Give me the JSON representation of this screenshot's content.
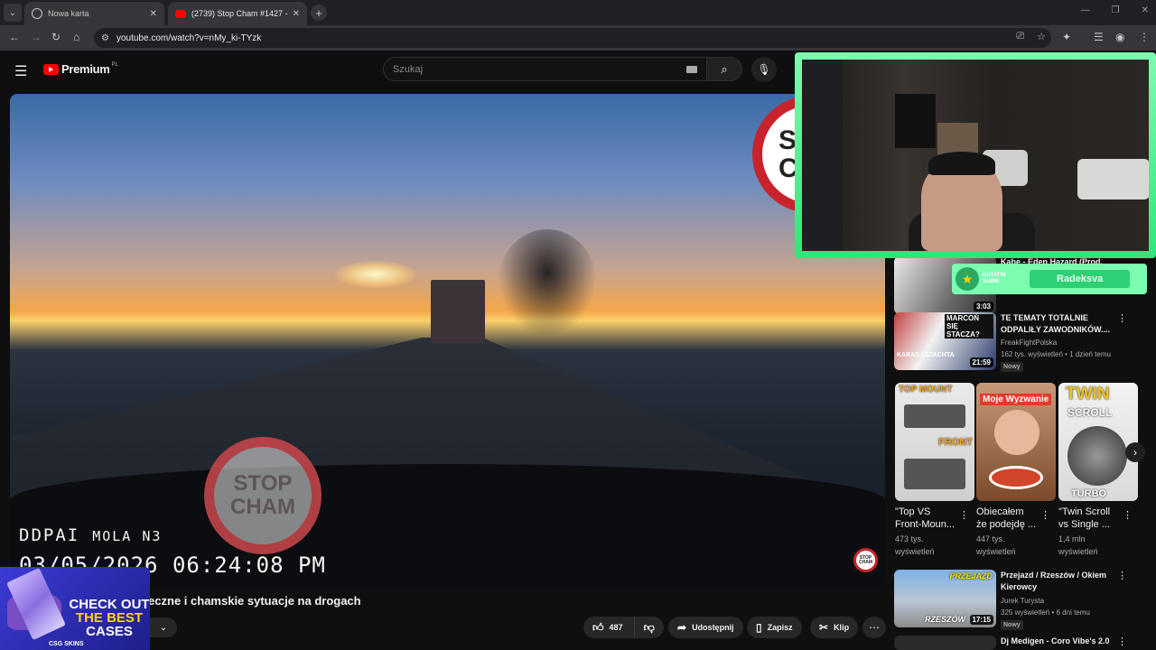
{
  "browser": {
    "tabs": [
      {
        "title": "Nowa karta",
        "active": false
      },
      {
        "title": "(2739) Stop Cham #1427 - Niebe",
        "active": true
      }
    ],
    "url": "youtube.com/watch?v=nMy_ki-TYzk"
  },
  "header": {
    "logo_text": "Premium",
    "logo_region": "PL",
    "search_placeholder": "Szukaj"
  },
  "player": {
    "dashcam_brand": "DDPAI",
    "dashcam_model": "MOLA N3",
    "dashcam_timestamp": "03/05/2026 06:24:08 PM",
    "watermark_line1": "STOP",
    "watermark_line2": "CHAM",
    "corner_logo_line1": "STOP",
    "corner_logo_line2": "CHAM",
    "big_logo_line1": "ST",
    "big_logo_line2": "C"
  },
  "video": {
    "title": "zpieczne i chamskie sytuacje na drogach",
    "likes": "487",
    "share_label": "Udostępnij",
    "save_label": "Zapisz",
    "clip_label": "Klip"
  },
  "ad": {
    "line1": "CHECK OUT",
    "line2": "THE BEST",
    "line3": "CASES",
    "brand": "CSG SKINS"
  },
  "stream_overlay": {
    "sub_label": "OSTATNI SUBIK",
    "sub_name": "Radeksva"
  },
  "sidebar": {
    "items": [
      {
        "title": "Kabe - Eden Hazard (Prod.",
        "channel": "",
        "meta": "",
        "duration": "3:03",
        "badge": ""
      },
      {
        "title": "TE TEMATY TOTALNIE ODPALIŁY ZAWODNIKÓW....",
        "channel": "FreakFightPolska",
        "meta": "162 tys. wyświetleń • 1 dzień temu",
        "duration": "21:59",
        "badge": "Nowy"
      },
      {
        "title": "Przejazd / Rzeszów / Okiem Kierowcy",
        "channel": "Jurek Turysta",
        "meta": "325 wyświetleń • 6 dni temu",
        "duration": "17:15",
        "badge": "Nowy"
      },
      {
        "title": "Dj Medigen - Coro Vibe's 2.0",
        "channel": "",
        "meta": "",
        "duration": "",
        "badge": ""
      }
    ],
    "shorts": [
      {
        "title": "\"Top VS\nFront-Moun...",
        "meta": "473 tys.\nwyświetleń",
        "overlay": ""
      },
      {
        "title": "Obiecałem\nże podejdę ...",
        "meta": "447 tys.\nwyświetleń",
        "overlay": "Moje Wyzwanie"
      },
      {
        "title": "\"Twin Scroll\nvs Single ...",
        "meta": "1,4 mln\nwyświetleń",
        "overlay": ""
      }
    ],
    "thumb2_text": "MARCOŃ SIĘ STACZA?",
    "thumb2_sub": "KARAŚ | SZACHTA",
    "thumb3_text": "PRZEJAZD",
    "thumb3_sub": "RZESZÓW",
    "short1_text": "TOP MOUNT",
    "short1_text2": "FRONT",
    "short3_text": "TWIN",
    "short3_text2": "SCROLL",
    "short3_text3": "TURBO"
  },
  "colors": {
    "accent_red": "#ff0000",
    "overlay_green": "#7cfcb0",
    "bg": "#0f0f0f"
  }
}
